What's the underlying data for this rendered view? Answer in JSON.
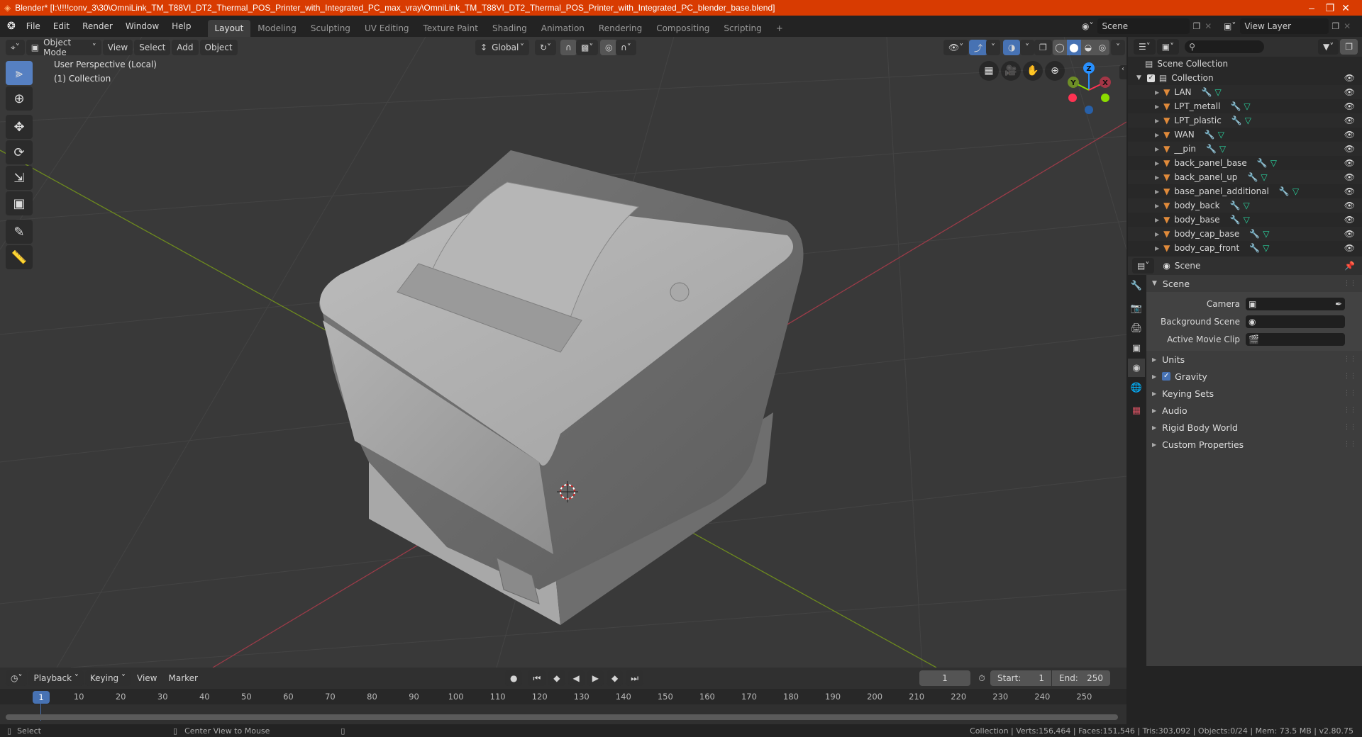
{
  "window": {
    "title": "Blender* [I:\\!!!!conv_3\\30\\OmniLink_TM_T88VI_DT2_Thermal_POS_Printer_with_Integrated_PC_max_vray\\OmniLink_TM_T88VI_DT2_Thermal_POS_Printer_with_Integrated_PC_blender_base.blend]",
    "minimize": "–",
    "maximize": "❐",
    "close": "✕"
  },
  "menus": [
    "File",
    "Edit",
    "Render",
    "Window",
    "Help"
  ],
  "workspaces": [
    {
      "label": "Layout",
      "active": true
    },
    {
      "label": "Modeling"
    },
    {
      "label": "Sculpting"
    },
    {
      "label": "UV Editing"
    },
    {
      "label": "Texture Paint"
    },
    {
      "label": "Shading"
    },
    {
      "label": "Animation"
    },
    {
      "label": "Rendering"
    },
    {
      "label": "Compositing"
    },
    {
      "label": "Scripting"
    }
  ],
  "add_workspace": "+",
  "scene_selector": {
    "value": "Scene"
  },
  "view_layer_selector": {
    "value": "View Layer"
  },
  "viewport_header": {
    "mode": "Object Mode",
    "menus": [
      "View",
      "Select",
      "Add",
      "Object"
    ],
    "orientation": "Global"
  },
  "viewport": {
    "perspective_label": "User Perspective (Local)",
    "collection_label": "(1) Collection",
    "gizmo": {
      "x": "X",
      "y": "Y",
      "z": "Z"
    },
    "colors": {
      "x": "#ff3352",
      "y": "#8bdc00",
      "z": "#2890ff",
      "grid": "#434343",
      "bg": "#393939"
    }
  },
  "outliner": {
    "search_placeholder": "",
    "root": "Scene Collection",
    "collection": "Collection",
    "objects": [
      "LAN",
      "LPT_metall",
      "LPT_plastic",
      "WAN",
      "__pin",
      "back_panel_base",
      "back_panel_up",
      "base_panel_additional",
      "body_back",
      "body_base",
      "body_cap_base",
      "body_cap_front"
    ]
  },
  "properties": {
    "context": "Scene",
    "panel_title": "Scene",
    "fields": [
      {
        "label": "Camera",
        "value": ""
      },
      {
        "label": "Background Scene",
        "value": ""
      },
      {
        "label": "Active Movie Clip",
        "value": ""
      }
    ],
    "sections": [
      "Units",
      "Gravity",
      "Keying Sets",
      "Audio",
      "Rigid Body World",
      "Custom Properties"
    ],
    "gravity_checked": true
  },
  "timeline": {
    "menus": [
      "Playback",
      "Keying",
      "View",
      "Marker"
    ],
    "current_frame": "1",
    "start_label": "Start:",
    "start": "1",
    "end_label": "End:",
    "end": "250",
    "ticks": [
      "10",
      "20",
      "30",
      "40",
      "50",
      "60",
      "70",
      "80",
      "90",
      "100",
      "110",
      "120",
      "130",
      "140",
      "150",
      "160",
      "170",
      "180",
      "190",
      "200",
      "210",
      "220",
      "230",
      "240",
      "250"
    ]
  },
  "statusbar": {
    "left_action": "Select",
    "middle_action": "Center View to Mouse",
    "stats": "Collection | Verts:156,464 | Faces:151,546 | Tris:303,092 | Objects:0/24 | Mem: 73.5 MB | v2.80.75"
  }
}
